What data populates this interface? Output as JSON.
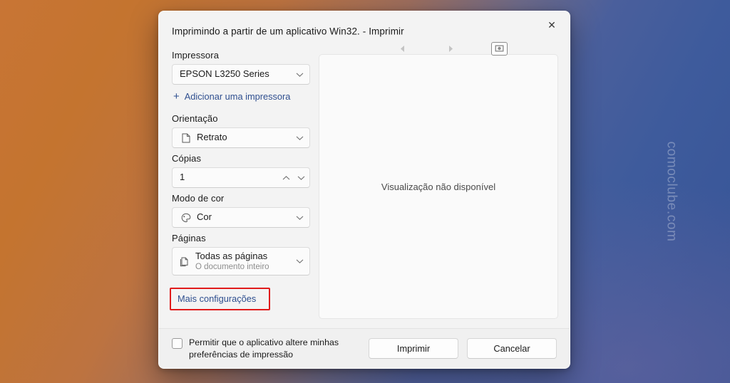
{
  "watermark": "comoclube.com",
  "dialog": {
    "title": "Imprimindo a partir de um aplicativo Win32. - Imprimir",
    "close_label": "✕",
    "toolbar": {
      "prev_icon": "triangle-left-icon",
      "next_icon": "triangle-right-icon",
      "fit_icon": "fit-to-page-icon"
    }
  },
  "settings": {
    "printer": {
      "label": "Impressora",
      "value": "EPSON L3250 Series"
    },
    "add_printer_link": "Adicionar uma impressora",
    "orientation": {
      "label": "Orientação",
      "value": "Retrato",
      "icon": "page-portrait-icon"
    },
    "copies": {
      "label": "Cópias",
      "value": "1"
    },
    "color_mode": {
      "label": "Modo de cor",
      "value": "Cor",
      "icon": "color-palette-icon"
    },
    "pages": {
      "label": "Páginas",
      "value": "Todas as páginas",
      "sub": "O documento inteiro",
      "icon": "pages-stack-icon"
    },
    "more_settings_link": "Mais configurações"
  },
  "preview": {
    "message": "Visualização não disponível"
  },
  "footer": {
    "checkbox_label": "Permitir que o aplicativo altere minhas preferências de impressão",
    "checkbox_checked": false,
    "print_button": "Imprimir",
    "cancel_button": "Cancelar"
  },
  "colors": {
    "accent_link": "#2f4f8f",
    "annotation_red": "#e01b1b",
    "dialog_bg": "#f3f3f3",
    "footer_bg": "#f0f0f0",
    "gradient_left": "#c87535",
    "gradient_right": "#3a5799"
  }
}
